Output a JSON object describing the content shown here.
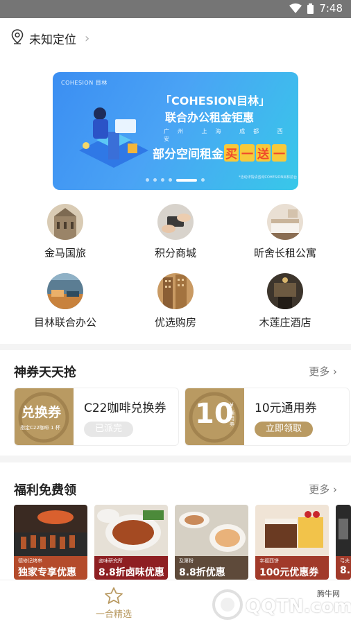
{
  "status": {
    "time": "7:48"
  },
  "location": {
    "text": "未知定位"
  },
  "banner": {
    "brand": "COHESION 目林",
    "title_line1": "「COHESION目林」",
    "title_line2": "联合办公租金钜惠",
    "cities": "广州 上海 成都 西安",
    "promo_prefix": "部分空间租金",
    "promo_mid": [
      "买",
      "一",
      "送",
      "一"
    ],
    "footnote": "*活动详情请咨询COHESION目林前台",
    "dots": 6,
    "active_dot": 5
  },
  "grid": [
    {
      "label": "金马国旅",
      "icon": "cathedral-photo"
    },
    {
      "label": "积分商城",
      "icon": "handshake-card-photo"
    },
    {
      "label": "昕舍长租公寓",
      "icon": "bedroom-photo"
    },
    {
      "label": "目林联合办公",
      "icon": "office-lounge-photo"
    },
    {
      "label": "优选购房",
      "icon": "apartment-building-photo"
    },
    {
      "label": "木莲庄酒店",
      "icon": "hotel-lobby-photo"
    }
  ],
  "coupons_section": {
    "title": "神券天天抢",
    "more": "更多",
    "items": [
      {
        "img_text_top": "兑换券",
        "img_text_bottom": "指定C22咖啡 1 杯",
        "name": "C22咖啡兑换券",
        "button": "已派完",
        "state": "out"
      },
      {
        "img_text_top": "10",
        "img_text_side": "通用券",
        "img_symbol": "¥",
        "name": "10元通用券",
        "button": "立即领取",
        "state": "available"
      }
    ]
  },
  "welfare_section": {
    "title": "福利免费领",
    "more": "更多",
    "items": [
      {
        "tag": "德修记烤串",
        "text": "独家专享优惠"
      },
      {
        "tag": "卤味研究所",
        "text": "8.8折卤味优惠"
      },
      {
        "tag": "及第粉",
        "text": "8.8折优惠"
      },
      {
        "tag": "幸福西饼",
        "text": "100元优惠券"
      },
      {
        "tag": "弓夫",
        "text": "8."
      }
    ]
  },
  "tabbar": {
    "active_label": "一合精选"
  },
  "watermark": {
    "line1": "腾牛网",
    "line2": "QQTN.com"
  }
}
